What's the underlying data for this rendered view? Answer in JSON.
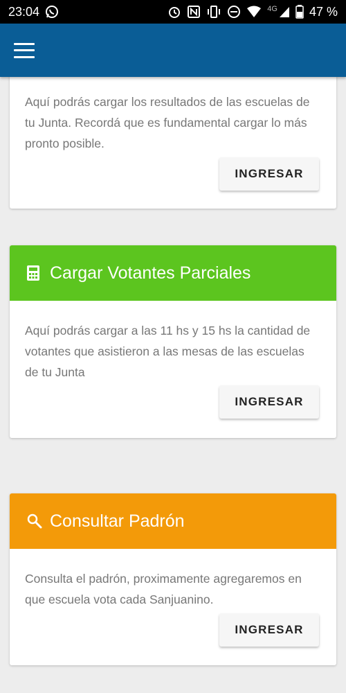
{
  "status_bar": {
    "time": "23:04",
    "network": "4G",
    "battery": "47 %"
  },
  "colors": {
    "app_bar": "#0a5d96",
    "votantes_header": "#5cc51f",
    "padron_header": "#f39a09"
  },
  "cards": [
    {
      "title": "",
      "description": "Aquí podrás cargar los resultados de las escuelas de tu Junta. Recordá que es fundamental cargar lo más pronto posible.",
      "button": "INGRESAR"
    },
    {
      "icon": "calculator-icon",
      "title": "Cargar Votantes Parciales",
      "description": "Aquí podrás cargar a las 11 hs y 15 hs la cantidad de votantes que asistieron a las mesas de las escuelas de tu Junta",
      "button": "INGRESAR"
    },
    {
      "icon": "search-icon",
      "title": "Consultar Padrón",
      "description": "Consulta el padrón, proximamente agregaremos en que escuela vota cada Sanjuanino.",
      "button": "INGRESAR"
    }
  ]
}
